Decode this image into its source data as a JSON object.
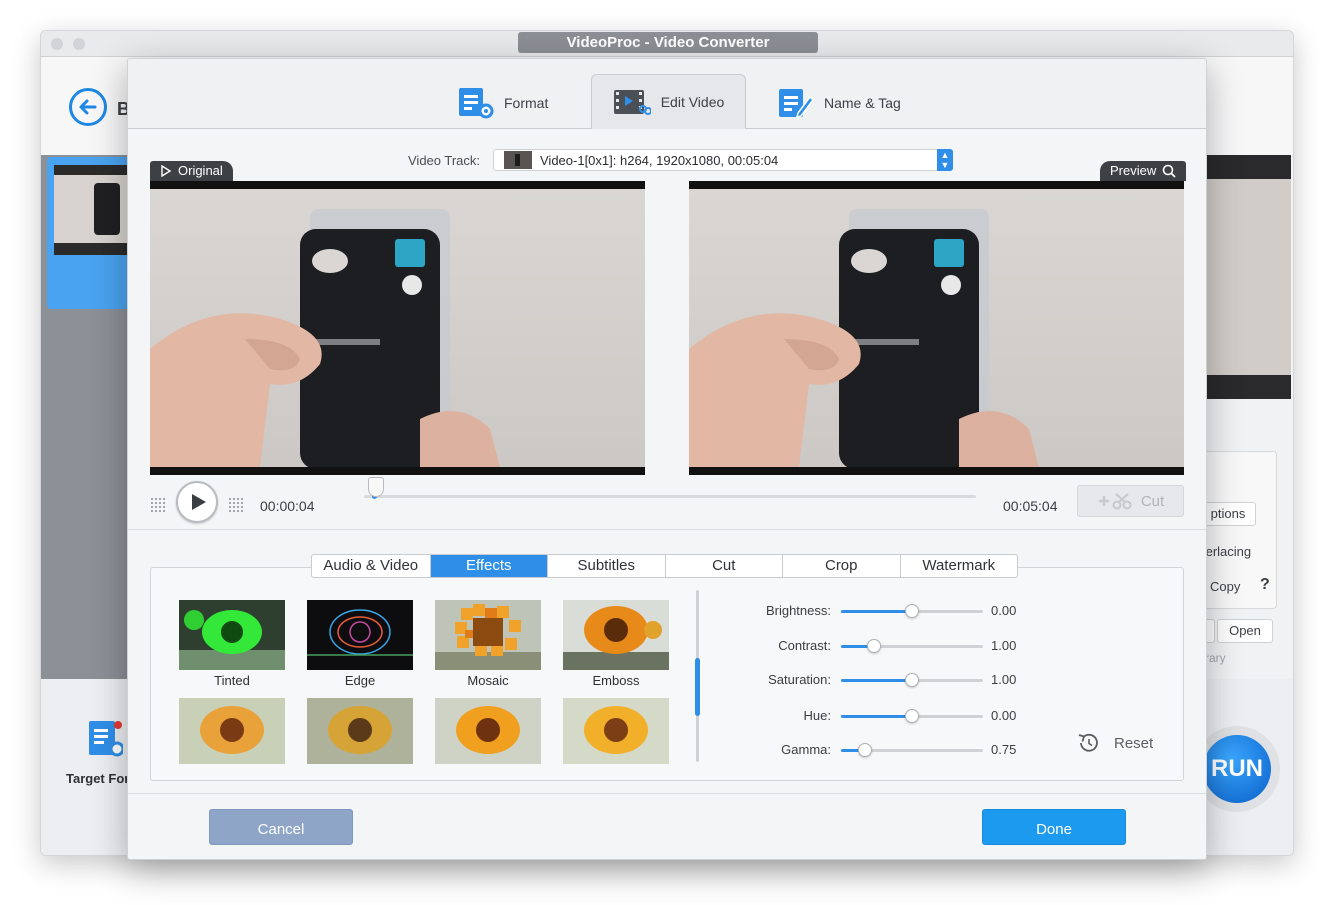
{
  "main_window": {
    "title": "VideoProc - Video Converter",
    "back_label_partial": "B",
    "target_format_label_partial": "Target For",
    "run_label": "RUN",
    "right_settings": {
      "options_partial": "ptions",
      "deinterlacing_partial": "terlacing",
      "copy_partial": "Copy",
      "help_glyph": "?",
      "browse_partial": "e",
      "open_label": "Open",
      "library_partial": "rary"
    }
  },
  "dialog": {
    "tabs": [
      {
        "label": "Format",
        "icon": "format-icon"
      },
      {
        "label": "Edit Video",
        "icon": "edit-video-icon",
        "active": true
      },
      {
        "label": "Name & Tag",
        "icon": "name-tag-icon"
      }
    ],
    "video_track": {
      "label": "Video Track:",
      "value": "Video-1[0x1]: h264, 1920x1080, 00:05:04"
    },
    "original_badge": "Original",
    "preview_badge": "Preview",
    "player": {
      "current_time": "00:00:04",
      "total_time": "00:05:04",
      "progress": 0.013,
      "cut_label": "Cut"
    },
    "sub_tabs": [
      "Audio & Video",
      "Effects",
      "Subtitles",
      "Cut",
      "Crop",
      "Watermark"
    ],
    "active_sub_tab": "Effects",
    "effects": [
      "Tinted",
      "Edge",
      "Mosaic",
      "Emboss",
      "",
      "",
      "",
      ""
    ],
    "adjustments": [
      {
        "name": "Brightness:",
        "value": "0.00",
        "position": 0.5
      },
      {
        "name": "Contrast:",
        "value": "1.00",
        "position": 0.23
      },
      {
        "name": "Saturation:",
        "value": "1.00",
        "position": 0.5
      },
      {
        "name": "Hue:",
        "value": "0.00",
        "position": 0.5
      },
      {
        "name": "Gamma:",
        "value": "0.75",
        "position": 0.17
      }
    ],
    "reset_label": "Reset",
    "cancel_label": "Cancel",
    "done_label": "Done"
  },
  "colors": {
    "accent": "#2f8fe8",
    "done_button": "#1c9af0",
    "cancel_button": "#8ea5c8"
  }
}
